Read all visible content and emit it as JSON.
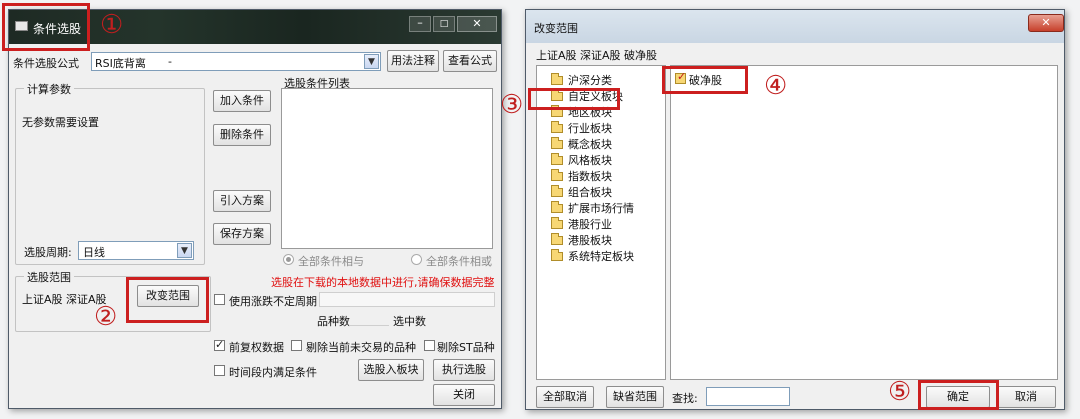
{
  "left_window": {
    "title": "条件选股",
    "formula_label": "条件选股公式",
    "formula_value": "RSI底背离",
    "formula_dash": "-",
    "usage_button": "用法注释",
    "view_formula_button": "查看公式",
    "params_group": "计算参数",
    "no_params": "无参数需要设置",
    "condition_list_label": "选股条件列表",
    "add_condition": "加入条件",
    "delete_condition": "删除条件",
    "import_scheme": "引入方案",
    "save_scheme": "保存方案",
    "period_label": "选股周期:",
    "period_value": "日线",
    "radio_all_and": "全部条件相与",
    "radio_all_or": "全部条件相或",
    "warning": "选股在下载的本地数据中进行,请确保数据完整",
    "range_group": "选股范围",
    "range_value": "上证A股  深证A股",
    "change_range": "改变范围",
    "use_volatile_period": "使用涨跌不定周期",
    "stock_count_label": "品种数",
    "selected_count_label": "选中数",
    "pre_adjust": "前复权数据",
    "exclude_untraded": "剔除当前未交易的品种",
    "exclude_st": "剔除ST品种",
    "time_range_condition": "时间段内满足条件",
    "select_into_block": "选股入板块",
    "execute_select": "执行选股",
    "close": "关闭"
  },
  "right_window": {
    "title": "改变范围",
    "current_range": "上证A股  深证A股  破净股",
    "tree_items": [
      "沪深分类",
      "自定义板块",
      "地区板块",
      "行业板块",
      "概念板块",
      "风格板块",
      "指数板块",
      "组合板块",
      "扩展市场行情",
      "港股行业",
      "港股板块",
      "系统特定板块"
    ],
    "selected_item": "破净股",
    "deselect_all": "全部取消",
    "default_range": "缺省范围",
    "search_label": "查找:",
    "ok": "确定",
    "cancel": "取消"
  },
  "annotations": {
    "n1": "①",
    "n2": "②",
    "n3": "③",
    "n4": "④",
    "n5": "⑤"
  },
  "colors": {
    "annotation_red": "#cc1f1f",
    "warning_red": "#e01010",
    "titlebar_dark": "#1c2a22"
  }
}
